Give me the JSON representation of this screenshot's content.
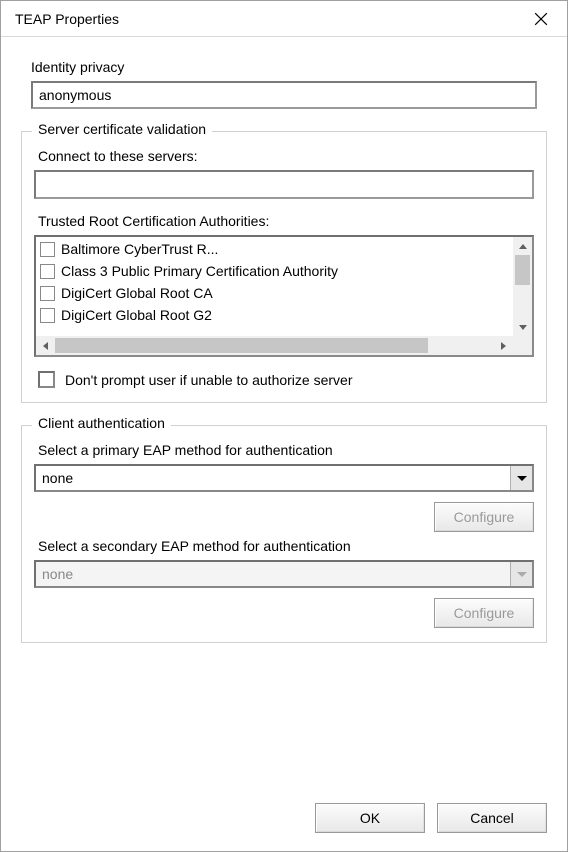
{
  "window": {
    "title": "TEAP Properties"
  },
  "identity": {
    "label": "Identity privacy",
    "value": "anonymous"
  },
  "server_validation": {
    "legend": "Server certificate validation",
    "connect_label": "Connect to these servers:",
    "connect_value": "",
    "trusted_label": "Trusted Root Certification Authorities:",
    "authorities": [
      "Baltimore CyberTrust R...",
      "Class 3 Public Primary Certification Authority",
      "DigiCert Global Root CA",
      "DigiCert Global Root G2"
    ],
    "dont_prompt_label": "Don't prompt user if unable to authorize server",
    "dont_prompt_checked": false
  },
  "client_auth": {
    "legend": "Client authentication",
    "primary_label": "Select a primary EAP method for authentication",
    "primary_value": "none",
    "primary_configure": "Configure",
    "secondary_label": "Select a secondary EAP method for authentication",
    "secondary_value": "none",
    "secondary_configure": "Configure"
  },
  "footer": {
    "ok": "OK",
    "cancel": "Cancel"
  }
}
